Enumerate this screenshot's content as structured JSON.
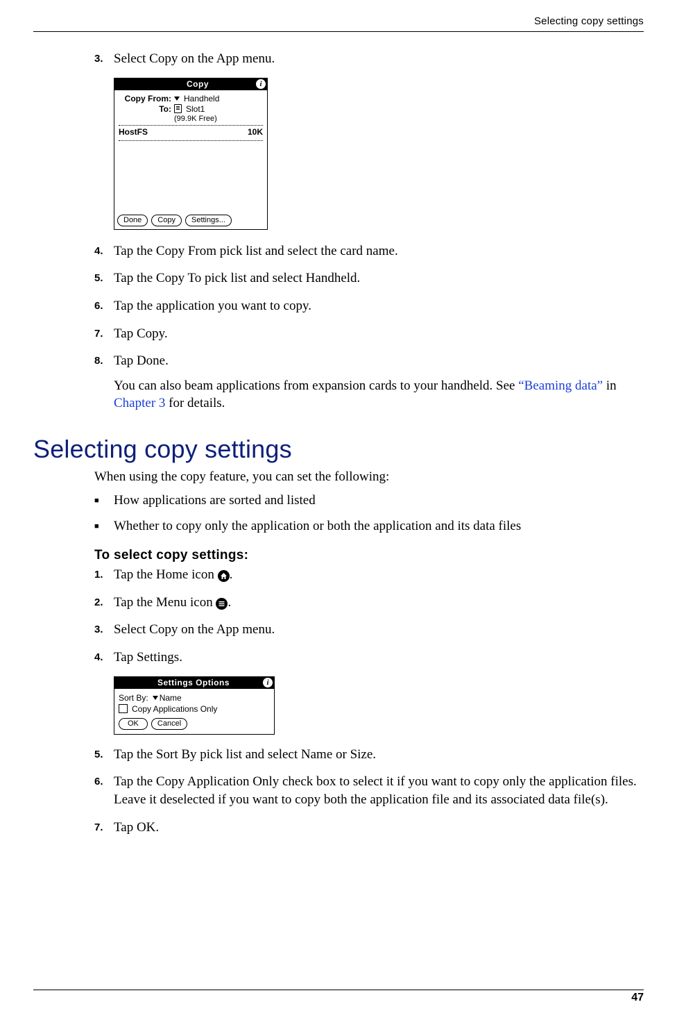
{
  "header": {
    "running_title": "Selecting copy settings"
  },
  "section1": {
    "steps": {
      "3": {
        "num": "3.",
        "text": "Select Copy on the App menu."
      },
      "4": {
        "num": "4.",
        "text": "Tap the Copy From pick list and select the card name."
      },
      "5": {
        "num": "5.",
        "text": "Tap the Copy To pick list and select Handheld."
      },
      "6": {
        "num": "6.",
        "text": "Tap the application you want to copy."
      },
      "7": {
        "num": "7.",
        "text": "Tap Copy."
      },
      "8": {
        "num": "8.",
        "text": "Tap Done."
      }
    },
    "note_pre": "You can also beam applications from expansion cards to your handheld. See ",
    "note_link1": "“Beaming data”",
    "note_mid": " in ",
    "note_link2": "Chapter 3",
    "note_post": " for details."
  },
  "palm_copy": {
    "title": "Copy",
    "from_label": "Copy From:",
    "from_value": "Handheld",
    "to_label": "To:",
    "to_value": "Slot1",
    "free": "(99.9K Free)",
    "item_name": "HostFS",
    "item_size": "10K",
    "btn_done": "Done",
    "btn_copy": "Copy",
    "btn_settings": "Settings..."
  },
  "section2": {
    "heading": "Selecting copy settings",
    "intro": "When using the copy feature, you can set the following:",
    "bullets": {
      "0": "How applications are sorted and listed",
      "1": "Whether to copy only the application or both the application and its data files"
    },
    "subhead": "To select copy settings:",
    "steps": {
      "1": {
        "num": "1.",
        "text_a": "Tap the Home icon ",
        "text_b": "."
      },
      "2": {
        "num": "2.",
        "text_a": "Tap the Menu icon ",
        "text_b": "."
      },
      "3": {
        "num": "3.",
        "text": "Select Copy on the App menu."
      },
      "4": {
        "num": "4.",
        "text": "Tap Settings."
      },
      "5": {
        "num": "5.",
        "text": "Tap the Sort By pick list and select Name or Size."
      },
      "6": {
        "num": "6.",
        "text": "Tap the Copy Application Only check box to select it if you want to copy only the application files. Leave it deselected if you want to copy both the application file and its associated data file(s)."
      },
      "7": {
        "num": "7.",
        "text": "Tap OK."
      }
    }
  },
  "palm_settings": {
    "title": "Settings Options",
    "sortby_label": "Sort By:",
    "sortby_value": "Name",
    "checkbox_label": "Copy Applications Only",
    "btn_ok": "OK",
    "btn_cancel": "Cancel"
  },
  "footer": {
    "page": "47"
  }
}
